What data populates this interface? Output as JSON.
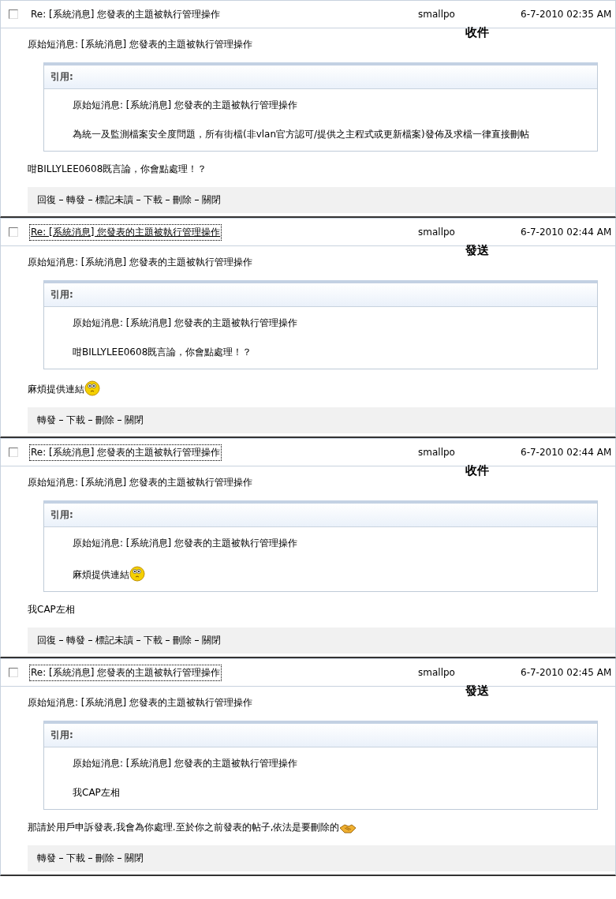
{
  "messages": [
    {
      "checked": false,
      "subject": "Re: [系統消息] 您發表的主題被執行管理操作",
      "subject_focused": false,
      "subject_hovered": false,
      "sender": "smallpo",
      "date": "6-7-2010 02:35 AM",
      "folder": "收件",
      "original": "原始短消息: [系統消息] 您發表的主題被執行管理操作",
      "quote": {
        "title": "引用:",
        "lines": [
          {
            "text": "原始短消息: [系統消息] 您發表的主題被執行管理操作"
          },
          {
            "text": "為統一及監測檔案安全度問題，所有街檔(非vlan官方認可/提供之主程式或更新檔案)發佈及求檔一律直接刪帖"
          }
        ]
      },
      "reply": {
        "text": "咁BILLYLEE0608既言論，你會點處理！？"
      },
      "actions": [
        "回復",
        "轉發",
        "標記未讀",
        "下載",
        "刪除",
        "關閉"
      ]
    },
    {
      "checked": false,
      "subject": "Re: [系統消息] 您發表的主題被執行管理操作",
      "subject_focused": true,
      "subject_hovered": true,
      "sender": "smallpo",
      "date": "6-7-2010 02:44 AM",
      "folder": "發送",
      "original": "原始短消息: [系統消息] 您發表的主題被執行管理操作",
      "quote": {
        "title": "引用:",
        "lines": [
          {
            "text": "原始短消息: [系統消息] 您發表的主題被執行管理操作"
          },
          {
            "text": "咁BILLYLEE0608既言論，你會點處理！？"
          }
        ]
      },
      "reply": {
        "text": "麻煩提供連結",
        "kind": "face"
      },
      "actions": [
        "轉發",
        "下載",
        "刪除",
        "關閉"
      ]
    },
    {
      "checked": false,
      "subject": "Re: [系統消息] 您發表的主題被執行管理操作",
      "subject_focused": true,
      "subject_hovered": false,
      "sender": "smallpo",
      "date": "6-7-2010 02:44 AM",
      "folder": "收件",
      "original": "原始短消息: [系統消息] 您發表的主題被執行管理操作",
      "quote": {
        "title": "引用:",
        "lines": [
          {
            "text": "原始短消息: [系統消息] 您發表的主題被執行管理操作"
          },
          {
            "text": "麻煩提供連結",
            "kind": "face"
          }
        ]
      },
      "reply": {
        "text": "我CAP左相"
      },
      "actions": [
        "回復",
        "轉發",
        "標記未讀",
        "下載",
        "刪除",
        "關閉"
      ]
    },
    {
      "checked": false,
      "subject": "Re: [系統消息] 您發表的主題被執行管理操作",
      "subject_focused": true,
      "subject_hovered": false,
      "sender": "smallpo",
      "date": "6-7-2010 02:45 AM",
      "folder": "發送",
      "original": "原始短消息: [系統消息] 您發表的主題被執行管理操作",
      "quote": {
        "title": "引用:",
        "lines": [
          {
            "text": "原始短消息: [系統消息] 您發表的主題被執行管理操作"
          },
          {
            "text": "我CAP左相"
          }
        ]
      },
      "reply": {
        "text": "那請於用戶申訴發表,我會為你處理.至於你之前發表的帖子,依法是要刪除的",
        "kind": "hands"
      },
      "actions": [
        "轉發",
        "下載",
        "刪除",
        "關閉"
      ]
    }
  ]
}
